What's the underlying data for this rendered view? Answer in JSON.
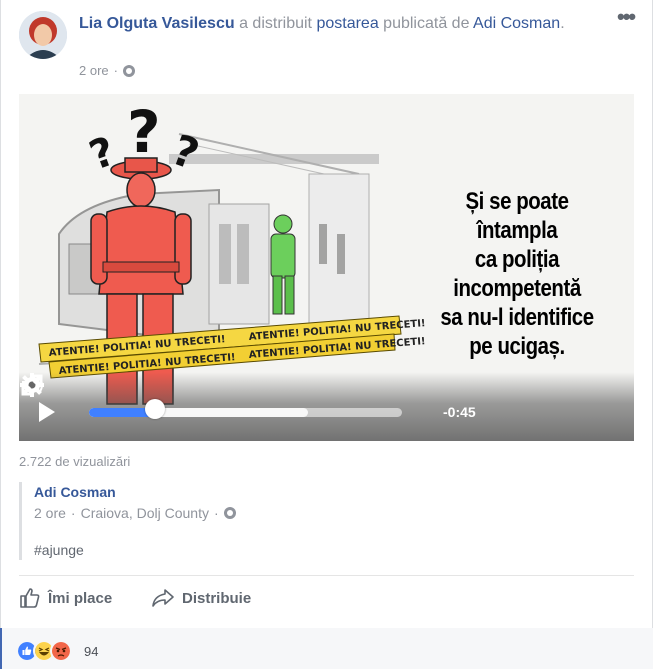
{
  "post": {
    "author": "Lia Olguta Vasilescu",
    "shared_text": "a distribuit",
    "post_link": "postarea",
    "published_by": "publicată de",
    "original_author": "Adi Cosman",
    "original_author_end": ".",
    "time": "2 ore",
    "separator": "·"
  },
  "video": {
    "caption_lines": [
      "Și se poate",
      "întampla",
      "ca poliția",
      "incompetentă",
      "sa nu-l identifice",
      "pe ucigaș."
    ],
    "tape_text": "ATENTIE!  POLITIA!  NU TRECETI!",
    "time_remaining": "-0:45",
    "progress_percent": 21,
    "buffered_percent": 70
  },
  "views": "2.722 de vizualizări",
  "shared": {
    "author": "Adi Cosman",
    "time": "2 ore",
    "location": "Craiova, Dolj County",
    "separator": "·",
    "hashtag": "#ajunge"
  },
  "actions": {
    "like": "Îmi place",
    "share": "Distribuie"
  },
  "reactions": {
    "count": "94",
    "types": [
      "like-icon",
      "haha-icon",
      "angry-icon"
    ],
    "colors": {
      "like": "#4080ff",
      "haha": "#fcd34d",
      "angry": "#f26649"
    }
  },
  "colors": {
    "link": "#365899",
    "muted": "#90949c",
    "accent": "#4080ff"
  }
}
